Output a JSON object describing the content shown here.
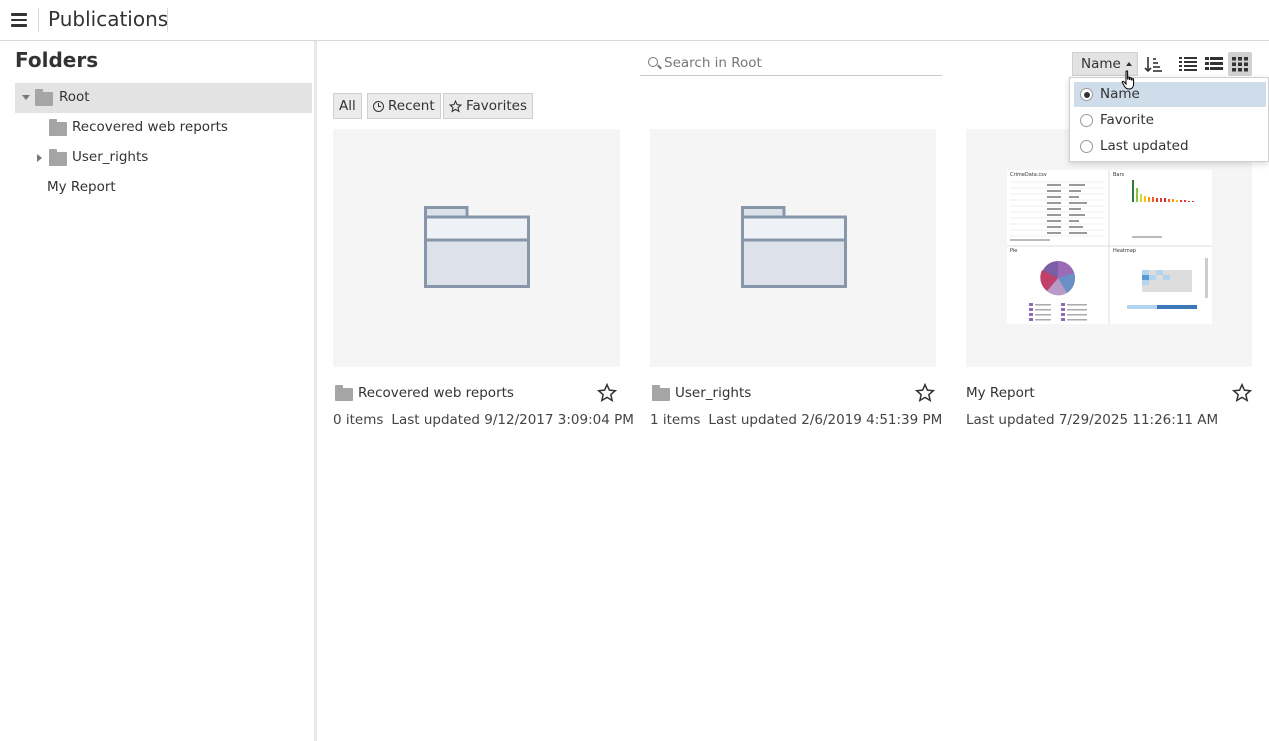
{
  "header": {
    "title": "Publications",
    "menu_icon": "hamburger-menu-icon"
  },
  "sidebar": {
    "title": "Folders",
    "tree": [
      {
        "label": "Root",
        "type": "folder",
        "expanded": true,
        "selected": true
      },
      {
        "label": "Recovered web reports",
        "type": "folder"
      },
      {
        "label": "User_rights",
        "type": "folder",
        "expanded": false
      },
      {
        "label": "My Report",
        "type": "report"
      }
    ]
  },
  "search": {
    "placeholder": "Search in Root",
    "value": ""
  },
  "sort": {
    "label": "Name",
    "options": [
      {
        "label": "Name",
        "selected": true
      },
      {
        "label": "Favorite",
        "selected": false
      },
      {
        "label": "Last updated",
        "selected": false
      }
    ]
  },
  "view_modes": [
    "list-view-icon",
    "detail-view-icon",
    "grid-view-icon"
  ],
  "active_view": "grid-view-icon",
  "filters": {
    "all": "All",
    "recent": "Recent",
    "favorites": "Favorites"
  },
  "items": [
    {
      "title": "Recovered web reports",
      "type": "folder",
      "count": "0 items",
      "updated": "Last updated 9/12/2017 3:09:04 PM"
    },
    {
      "title": "User_rights",
      "type": "folder",
      "count": "1 items",
      "updated": "Last updated 2/6/2019 4:51:39 PM"
    },
    {
      "title": "My Report",
      "type": "report",
      "updated": "Last updated 7/29/2025 11:26:11 AM",
      "thumbnail": {
        "panel1": "CrimeData.csv",
        "panel2": "Bars",
        "panel3": "Pie",
        "panel4": "Heatmap"
      }
    }
  ],
  "colors": {
    "folder_gray": "#a5a5a5",
    "big_folder_stroke": "#8896aa",
    "highlight": "#cfdcea",
    "selected_tree": "#e3e3e3"
  }
}
